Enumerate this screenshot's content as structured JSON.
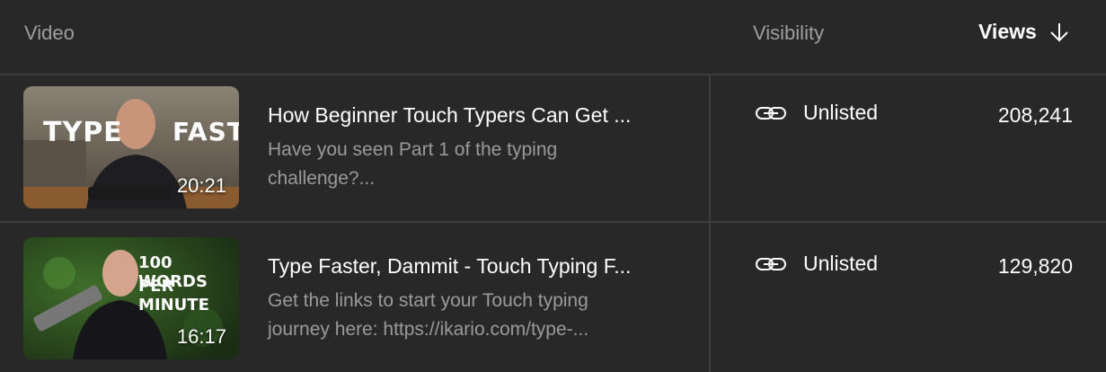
{
  "header": {
    "video_label": "Video",
    "visibility_label": "Visibility",
    "views_label": "Views",
    "sort_icon": "arrow-down-icon"
  },
  "rows": [
    {
      "title": "How Beginner Touch Typers Can Get ...",
      "description": "Have you seen Part 1 of the typing challenge?...",
      "duration": "20:21",
      "thumbnail_text_left": "TYPE",
      "thumbnail_text_right": "FAST",
      "visibility_icon": "link-icon",
      "visibility": "Unlisted",
      "views": "208,241"
    },
    {
      "title": "Type Faster, Dammit - Touch Typing F...",
      "description": "Get the links to start your Touch typing journey here: https://ikario.com/type-...",
      "duration": "16:17",
      "thumbnail_text_line1": "100 WORDS",
      "thumbnail_text_line2": "PER MINUTE",
      "visibility_icon": "link-icon",
      "visibility": "Unlisted",
      "views": "129,820"
    }
  ],
  "colors": {
    "background": "#282828",
    "divider": "#3d3d3d",
    "muted_text": "#9e9e9e",
    "text": "#ffffff"
  }
}
